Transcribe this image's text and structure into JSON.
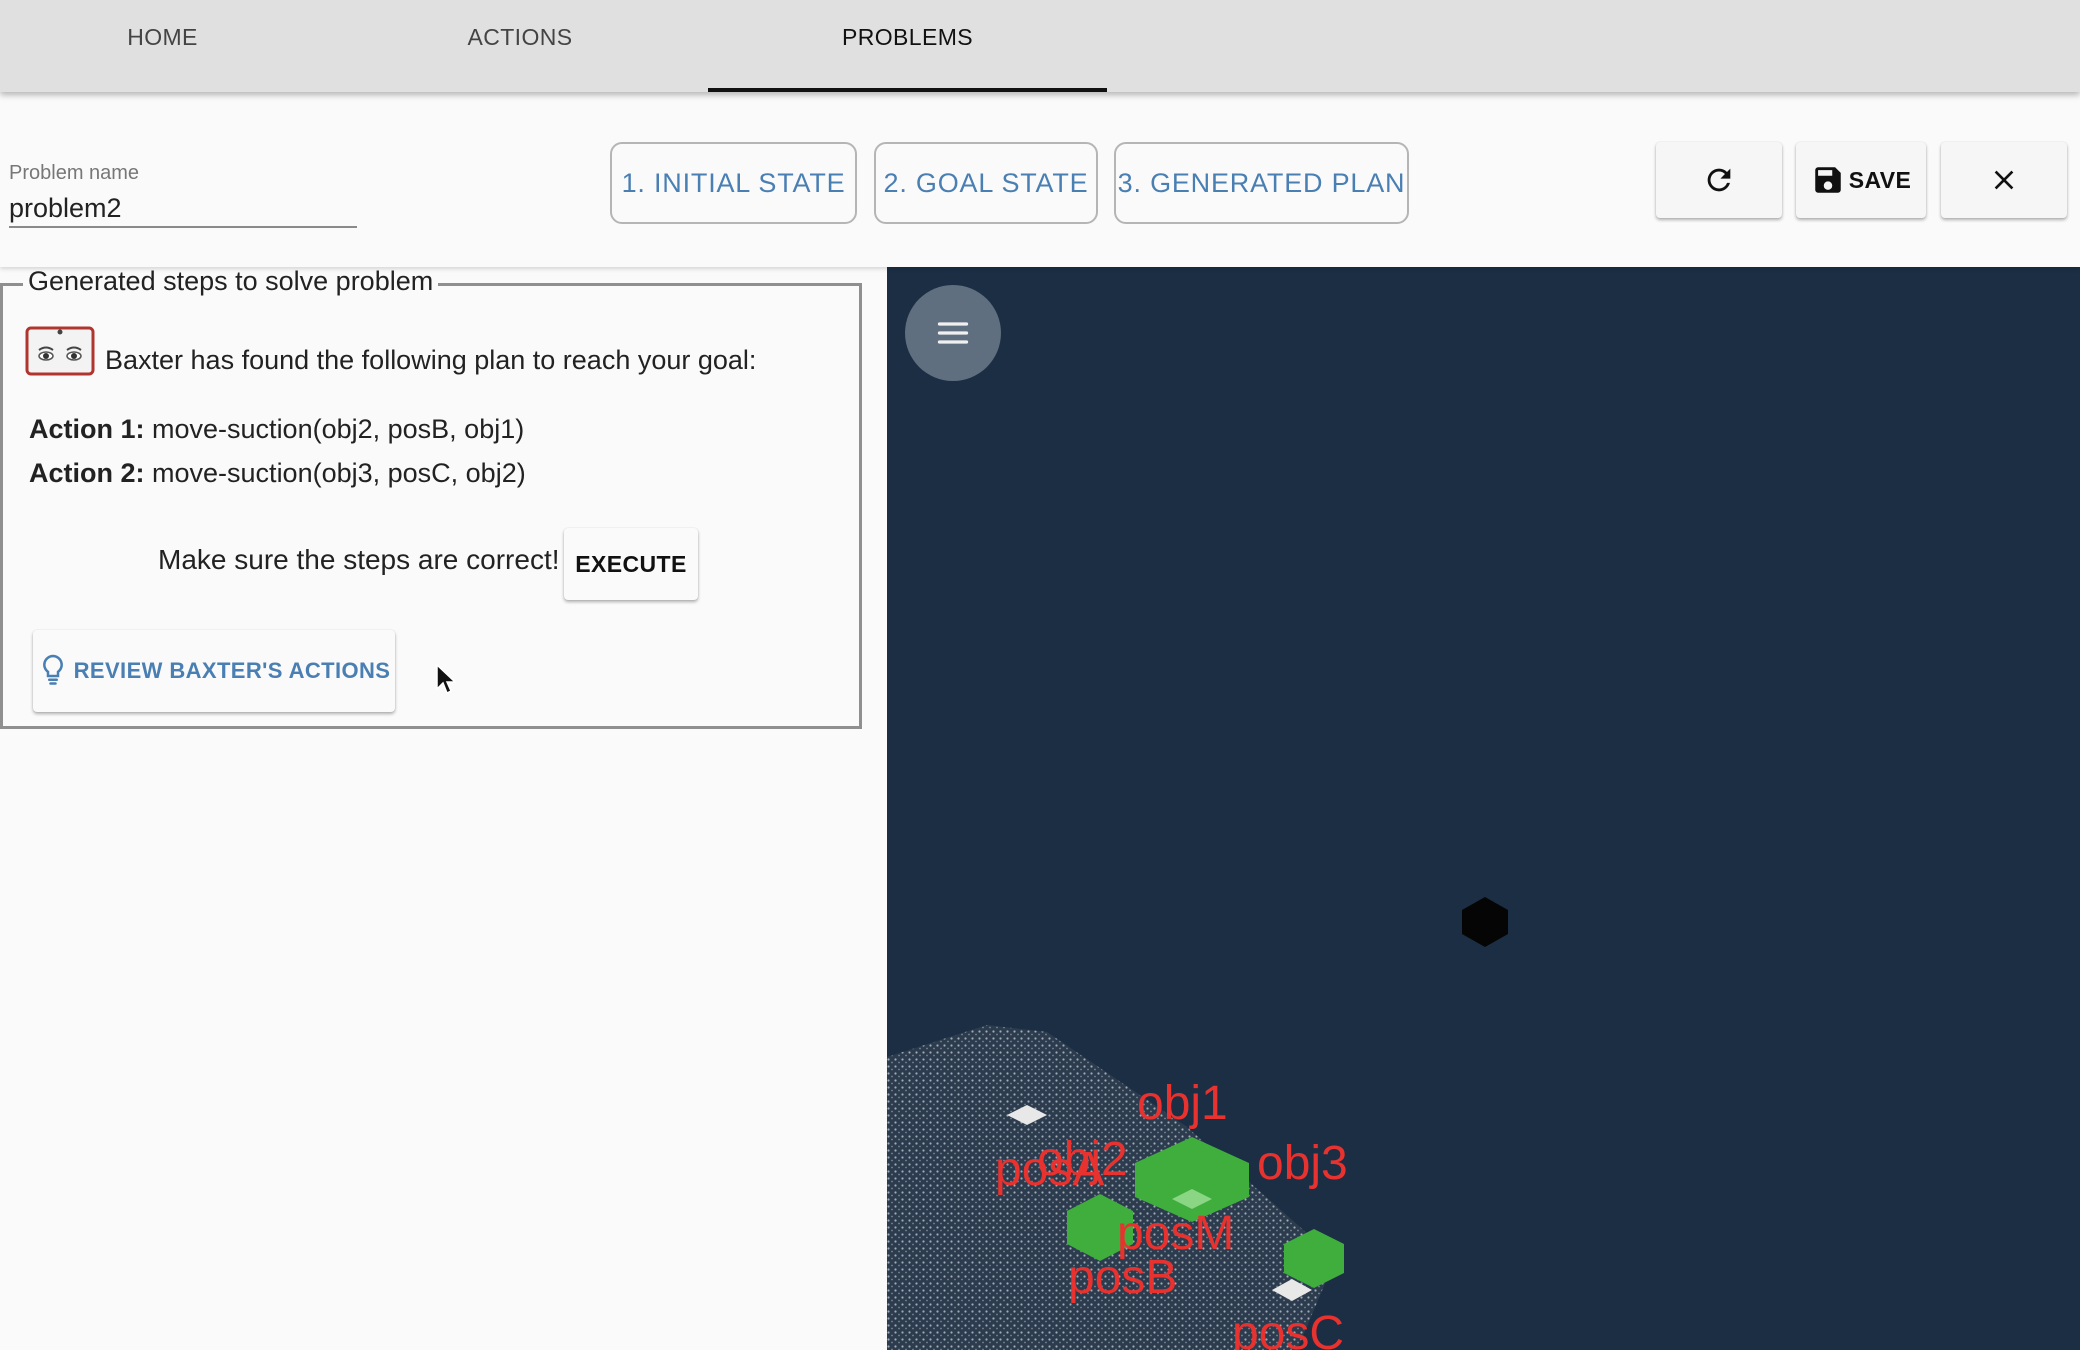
{
  "nav": {
    "tabs": [
      {
        "label": "HOME"
      },
      {
        "label": "ACTIONS"
      },
      {
        "label": "PROBLEMS",
        "active": true
      }
    ]
  },
  "toolbar": {
    "problem_name_label": "Problem name",
    "problem_name_value": "problem2",
    "steps": [
      {
        "label": "1. INITIAL STATE"
      },
      {
        "label": "2. GOAL STATE"
      },
      {
        "label": "3. GENERATED PLAN"
      }
    ],
    "refresh_icon": "refresh-icon",
    "save_icon": "floppy-disk-icon",
    "save_label": "SAVE",
    "close_icon": "close-icon"
  },
  "plan": {
    "legend": "Generated steps to solve problem",
    "intro": "Baxter has found the following plan to reach your goal:",
    "actions": [
      {
        "label": "Action 1:",
        "value": "move-suction(obj2, posB, obj1)"
      },
      {
        "label": "Action 2:",
        "value": "move-suction(obj3, posC, obj2)"
      }
    ],
    "confirm_text": "Make sure the steps are correct!",
    "execute_label": "EXECUTE",
    "review_label": "REVIEW BAXTER'S ACTIONS",
    "review_icon": "lightbulb-icon"
  },
  "viewport": {
    "menu_icon": "hamburger-menu-icon",
    "labels": {
      "obj1": "obj1",
      "obj2": "obj2",
      "obj3": "obj3",
      "posA": "posA",
      "posB": "posB",
      "posM": "posM",
      "posC": "posC"
    },
    "colors": {
      "background": "#1b2e44",
      "label": "#e8322f",
      "object": "#3fae3c",
      "table_points": "#9aa6b2"
    }
  }
}
